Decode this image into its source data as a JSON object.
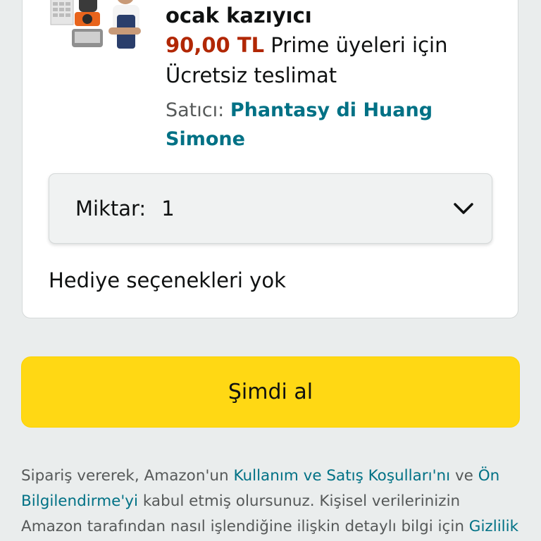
{
  "product": {
    "title_tail": "ocak kazıyıcı",
    "price": "90,00 TL",
    "price_suffix": " Prime üyeleri için",
    "delivery": "Ücretsiz teslimat",
    "seller_label": "Satıcı: ",
    "seller_name": "Phantasy di Huang Simone",
    "image_icon": "product-thumbnail"
  },
  "quantity": {
    "label": "Miktar:",
    "value": "1",
    "icon": "chevron-down-icon"
  },
  "gift": {
    "text": "Hediye seçenekleri yok"
  },
  "buy_now": {
    "label": "Şimdi al"
  },
  "legal": {
    "t1": "Sipariş vererek, Amazon'un ",
    "link1": "Kullanım ve Satış Koşulları'nı",
    "t2": " ve ",
    "link2": "Ön Bilgilendirme'yi",
    "t3": " kabul etmiş olursunuz. Kişisel verilerinizin Amazon tarafından nasıl işlendiğine ilişkin detaylı bilgi için ",
    "link3": "Gizlilik Bildirimi",
    "t4": ","
  },
  "colors": {
    "price": "#b12704",
    "link": "#007185",
    "buy_button": "#ffd814",
    "background": "#eaeded"
  }
}
